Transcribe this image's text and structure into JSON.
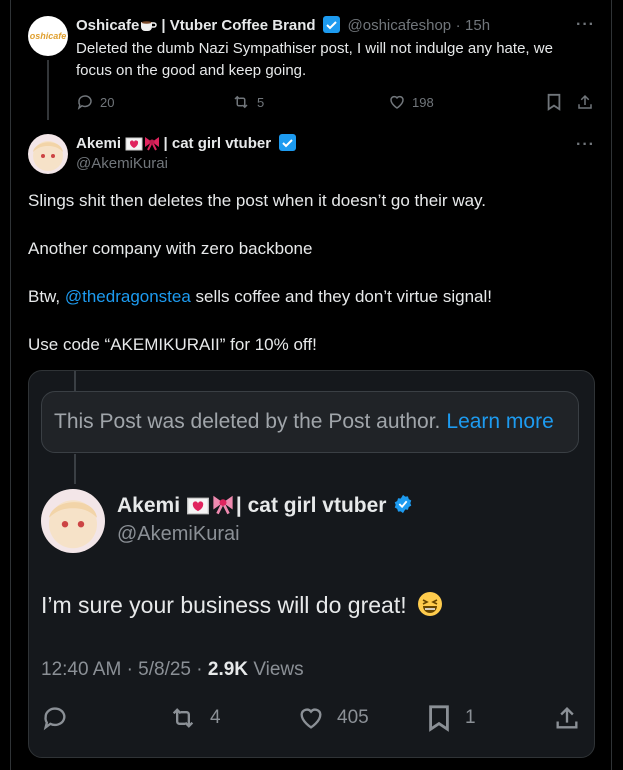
{
  "tweet1": {
    "avatar_text": "oshicafe",
    "name": "Oshicafe",
    "name_suffix": "| Vtuber Coffee Brand",
    "handle": "@oshicafeshop",
    "time": "15h",
    "text": "Deleted the dumb Nazi Sympathiser post, I will not indulge any hate, we focus on the good and keep going.",
    "replies": "20",
    "reposts": "5",
    "likes": "198"
  },
  "tweet2": {
    "name": "Akemi",
    "name_suffix": "| cat girl vtuber",
    "handle": "@AkemiKurai",
    "line1": "Slings shit then deletes the post when it doesn’t go their way.",
    "line2": "Another company with zero backbone",
    "line3_pre": "Btw, ",
    "line3_mention": "@thedragonstea",
    "line3_post": " sells coffee and they don’t virtue signal!",
    "line4": "Use code “AKEMIKURAII” for 10% off!"
  },
  "embed": {
    "deleted_text": "This Post was deleted by the Post author.",
    "learn_more": "Learn more",
    "name": "Akemi",
    "name_suffix": "| cat girl vtuber",
    "handle": "@AkemiKurai",
    "text": "I’m sure your business will do great!",
    "time": "12:40 AM",
    "date": "5/8/25",
    "views_count": "2.9K",
    "views_label": "Views",
    "reposts": "4",
    "likes": "405",
    "bookmarks": "1"
  },
  "colors": {
    "background": "#000000",
    "accent": "#1d9bf0",
    "muted": "#71767b"
  }
}
